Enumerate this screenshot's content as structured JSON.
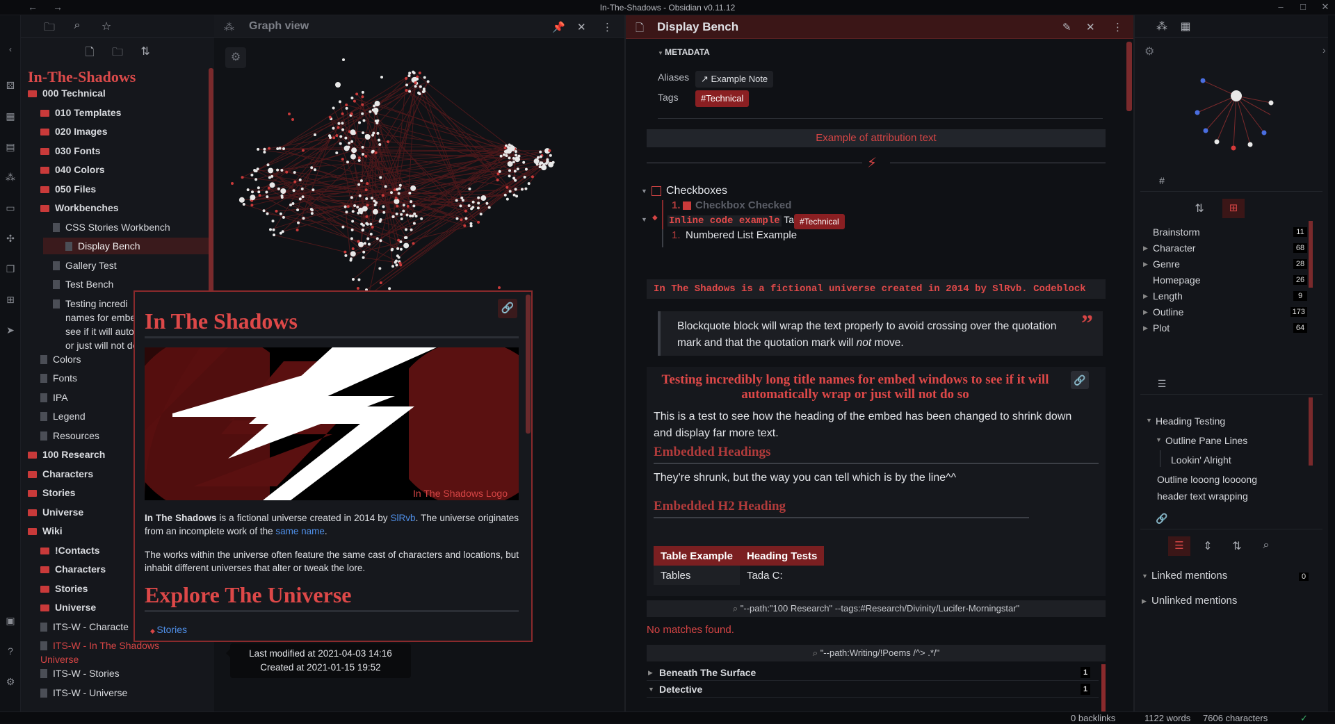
{
  "window": {
    "title": "In-The-Shadows - Obsidian v0.11.12"
  },
  "left_panel": {
    "vault_name": "In-The-Shadows",
    "tree": [
      {
        "label": "000 Technical",
        "kind": "folder",
        "level": 0,
        "bold": true
      },
      {
        "label": "010 Templates",
        "kind": "folder",
        "level": 1,
        "bold": true
      },
      {
        "label": "020 Images",
        "kind": "folder",
        "level": 1,
        "bold": true
      },
      {
        "label": "030 Fonts",
        "kind": "folder",
        "level": 1,
        "bold": true
      },
      {
        "label": "040 Colors",
        "kind": "folder",
        "level": 1,
        "bold": true
      },
      {
        "label": "050 Files",
        "kind": "folder",
        "level": 1,
        "bold": true
      },
      {
        "label": "Workbenches",
        "kind": "folder",
        "level": 1,
        "bold": true
      },
      {
        "label": "CSS Stories Workbench",
        "kind": "file",
        "level": 2
      },
      {
        "label": "Display Bench",
        "kind": "file",
        "level": 2,
        "active": true
      },
      {
        "label": "Gallery Test",
        "kind": "file",
        "level": 2
      },
      {
        "label": "Test Bench",
        "kind": "file",
        "level": 2
      },
      {
        "label": "Testing incredi",
        "kind": "file",
        "level": 2
      },
      {
        "label": "names for embed",
        "kind": "cont",
        "level": 2
      },
      {
        "label": "see if it will autom",
        "kind": "cont",
        "level": 2
      },
      {
        "label": "or just will not do",
        "kind": "cont",
        "level": 2
      },
      {
        "label": "Colors",
        "kind": "file",
        "level": 1
      },
      {
        "label": "Fonts",
        "kind": "file",
        "level": 1
      },
      {
        "label": "IPA",
        "kind": "file",
        "level": 1
      },
      {
        "label": "Legend",
        "kind": "file",
        "level": 1
      },
      {
        "label": "Resources",
        "kind": "file",
        "level": 1
      },
      {
        "label": "100 Research",
        "kind": "folder",
        "level": 0,
        "bold": true
      },
      {
        "label": "Characters",
        "kind": "folder",
        "level": 0,
        "bold": true
      },
      {
        "label": "Stories",
        "kind": "folder",
        "level": 0,
        "bold": true
      },
      {
        "label": "Universe",
        "kind": "folder",
        "level": 0,
        "bold": true
      },
      {
        "label": "Wiki",
        "kind": "folder",
        "level": 0,
        "bold": true
      },
      {
        "label": "!Contacts",
        "kind": "folder",
        "level": 1,
        "bold": true
      },
      {
        "label": "Characters",
        "kind": "folder",
        "level": 1,
        "bold": true
      },
      {
        "label": "Stories",
        "kind": "folder",
        "level": 1,
        "bold": true
      },
      {
        "label": "Universe",
        "kind": "folder",
        "level": 1,
        "bold": true
      },
      {
        "label": "ITS-W - Characte",
        "kind": "file",
        "level": 1
      },
      {
        "label": "ITS-W - In The Shadows",
        "kind": "file",
        "level": 1,
        "red": true
      },
      {
        "label": "Universe",
        "kind": "cont",
        "level": 0,
        "red": true
      },
      {
        "label": "ITS-W - Stories",
        "kind": "file",
        "level": 1
      },
      {
        "label": "ITS-W - Universe",
        "kind": "file",
        "level": 1
      }
    ]
  },
  "graph_pane": {
    "title": "Graph view"
  },
  "popover": {
    "title": "In The Shadows",
    "caption": "In The Shadows Logo",
    "p1_bold": "In The Shadows",
    "p1_a": " is a fictional universe created in 2014 by ",
    "p1_link1": "SlRvb",
    "p1_b": ". The universe originates from an incomplete work of the ",
    "p1_link2": "same name",
    "p1_c": ".",
    "p2": "The works within the universe often feature the same cast of characters and locations, but inhabit different universes that alter or tweak the lore.",
    "h2": "Explore The Universe",
    "li": "Stories"
  },
  "tooltip": {
    "line1": "Last modified at 2021-04-03 14:16",
    "line2": "Created at 2021-01-15 19:52"
  },
  "editor": {
    "title": "Display Bench",
    "metadata_label": "METADATA",
    "aliases_key": "Aliases",
    "aliases_value": "Example Note",
    "tags_key": "Tags",
    "tags_value": "#Technical",
    "attribution": "Example of attribution text",
    "checkboxes_label": "Checkboxes",
    "checked_item": "Checkbox Checked",
    "inline_code": "Inline code example",
    "tags_inline_label": "Tags:",
    "tags_inline_value": "#Technical",
    "numbered_item": "Numbered List Example",
    "codeblock": "In The Shadows is a fictional universe created in 2014 by SlRvb. Codeblock",
    "blockquote_a": "Blockquote block will wrap the text properly to avoid crossing over the quotation mark and that the quotation mark will ",
    "blockquote_em": "not",
    "blockquote_b": " move.",
    "quote_mark": "”",
    "embed_title": "Testing incredibly long title names for embed windows to see if it will automatically wrap or just will not do so",
    "embed_p1": "This is a test to see how the heading of the embed has been changed to shrink down and display far more text.",
    "embed_h1": "Embedded Headings",
    "embed_p2": "They're shrunk, but the way you can tell which is by the line^^",
    "embed_h2": "Embedded H2 Heading",
    "table_headers": [
      "Table Example",
      "Heading Tests"
    ],
    "table_row": [
      "Tables",
      "Tada C:"
    ],
    "query1": "\"--path:\"100 Research\" --tags:#Research/Divinity/Lucifer-Morningstar\"",
    "no_matches": "No matches found.",
    "query2": "\"--path:Writing/!Poems /^> .*/\"",
    "results": [
      {
        "label": "Beneath The Surface",
        "count": "1"
      },
      {
        "label": "Detective",
        "count": "1"
      }
    ]
  },
  "right_panel": {
    "tags": [
      {
        "label": "Brainstorm",
        "count": "11",
        "chev": false
      },
      {
        "label": "Character",
        "count": "68",
        "chev": true
      },
      {
        "label": "Genre",
        "count": "28",
        "chev": true
      },
      {
        "label": "Homepage",
        "count": "26",
        "chev": false
      },
      {
        "label": "Length",
        "count": "9",
        "chev": true
      },
      {
        "label": "Outline",
        "count": "173",
        "chev": true
      },
      {
        "label": "Plot",
        "count": "64",
        "chev": true
      }
    ],
    "outline": [
      "Heading Testing",
      "Outline Pane Lines",
      "Lookin' Alright",
      "Outline looong loooong",
      "header text wrapping"
    ],
    "linked": "Linked mentions",
    "linked_count": "0",
    "unlinked": "Unlinked mentions"
  },
  "status": {
    "backlinks": "0 backlinks",
    "words": "1122 words",
    "chars": "7606 characters"
  },
  "colors": {
    "accent": "#d64545",
    "bg": "#0f1115",
    "link": "#4f8fe8"
  }
}
